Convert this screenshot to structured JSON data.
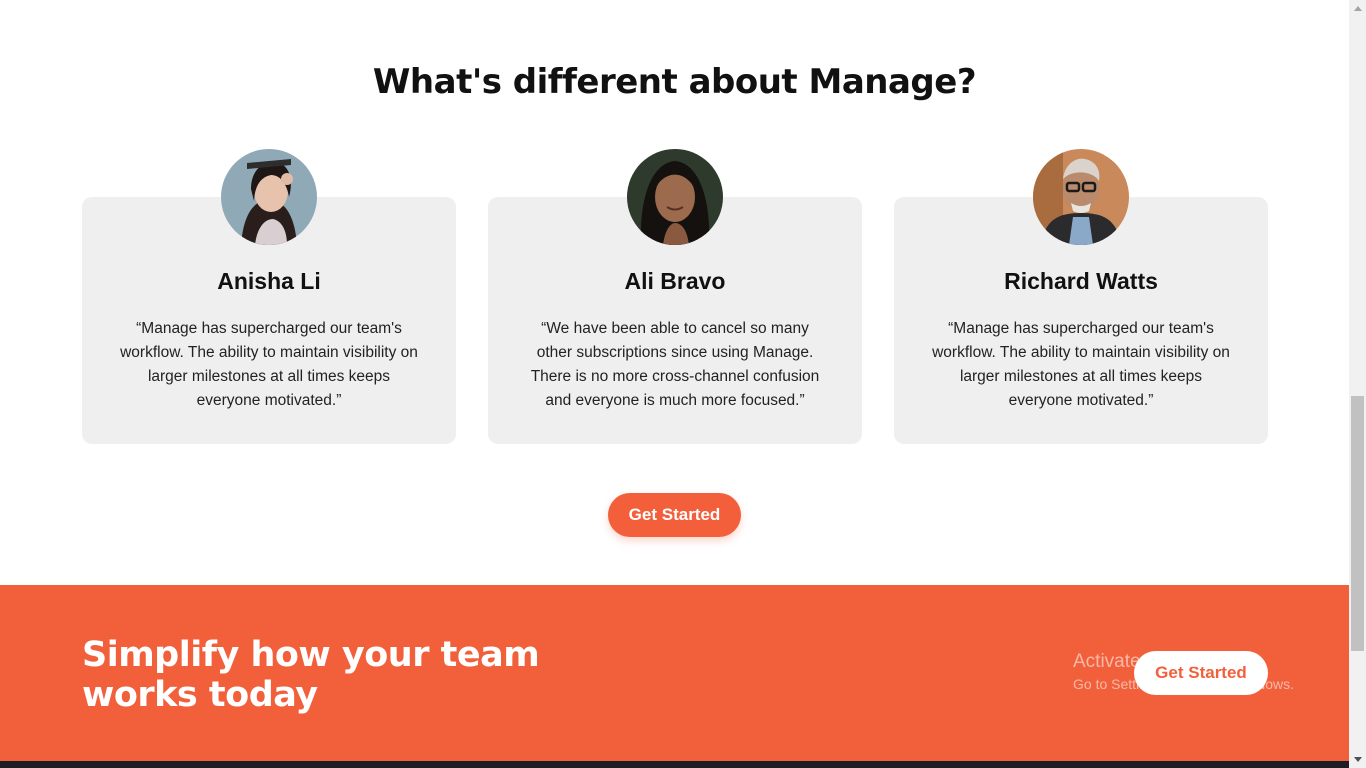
{
  "section": {
    "title": "What's different about Manage?"
  },
  "testimonials": [
    {
      "name": "Anisha Li",
      "quote": "“Manage has supercharged our team's workflow. The ability to maintain visibility on larger milestones at all times keeps everyone motivated.”",
      "avatar_icon": "avatar-woman-photo"
    },
    {
      "name": "Ali Bravo",
      "quote": "“We have been able to cancel so many other subscriptions since using Manage. There is no more cross-channel confusion and everyone is much more focused.”",
      "avatar_icon": "avatar-woman-photo"
    },
    {
      "name": "Richard Watts",
      "quote": "“Manage has supercharged our team's workflow. The ability to maintain visibility on larger milestones at all times keeps everyone motivated.”",
      "avatar_icon": "avatar-man-photo"
    }
  ],
  "cta": {
    "label": "Get Started"
  },
  "band": {
    "title": "Simplify how your team works today",
    "button_label": "Get Started"
  },
  "watermark": {
    "line1": "Activate Windows",
    "line2": "Go to Settings to activate Windows."
  },
  "colors": {
    "accent": "#f2603b",
    "card_bg": "#efefef",
    "footer": "#1d1e25"
  }
}
